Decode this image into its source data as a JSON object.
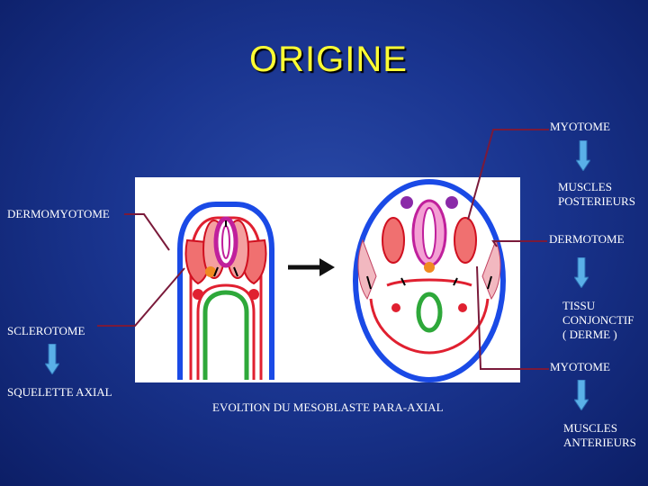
{
  "slide": {
    "title": "ORIGINE",
    "caption": "EVOLTION DU MESOBLASTE PARA-AXIAL"
  },
  "labels": {
    "myotome_top": "MYOTOME",
    "muscles_posterieurs_1": "MUSCLES",
    "muscles_posterieurs_2": "POSTERIEURS",
    "dermomyotome": "DERMOMYOTOME",
    "dermotome": "DERMOTOME",
    "tissu_1": "TISSU",
    "tissu_2": "CONJONCTIF",
    "tissu_3": "( DERME )",
    "sclerotome": "SCLEROTOME",
    "squelette": "SQUELETTE AXIAL",
    "myotome_bottom": "MYOTOME",
    "muscles_anterieurs_1": "MUSCLES",
    "muscles_anterieurs_2": "ANTERIEURS"
  },
  "colors": {
    "title": "#ffff33",
    "background": "#1a3590",
    "arrow_fill": "#5ab0e8",
    "leader_line": "#7a1a3a"
  }
}
